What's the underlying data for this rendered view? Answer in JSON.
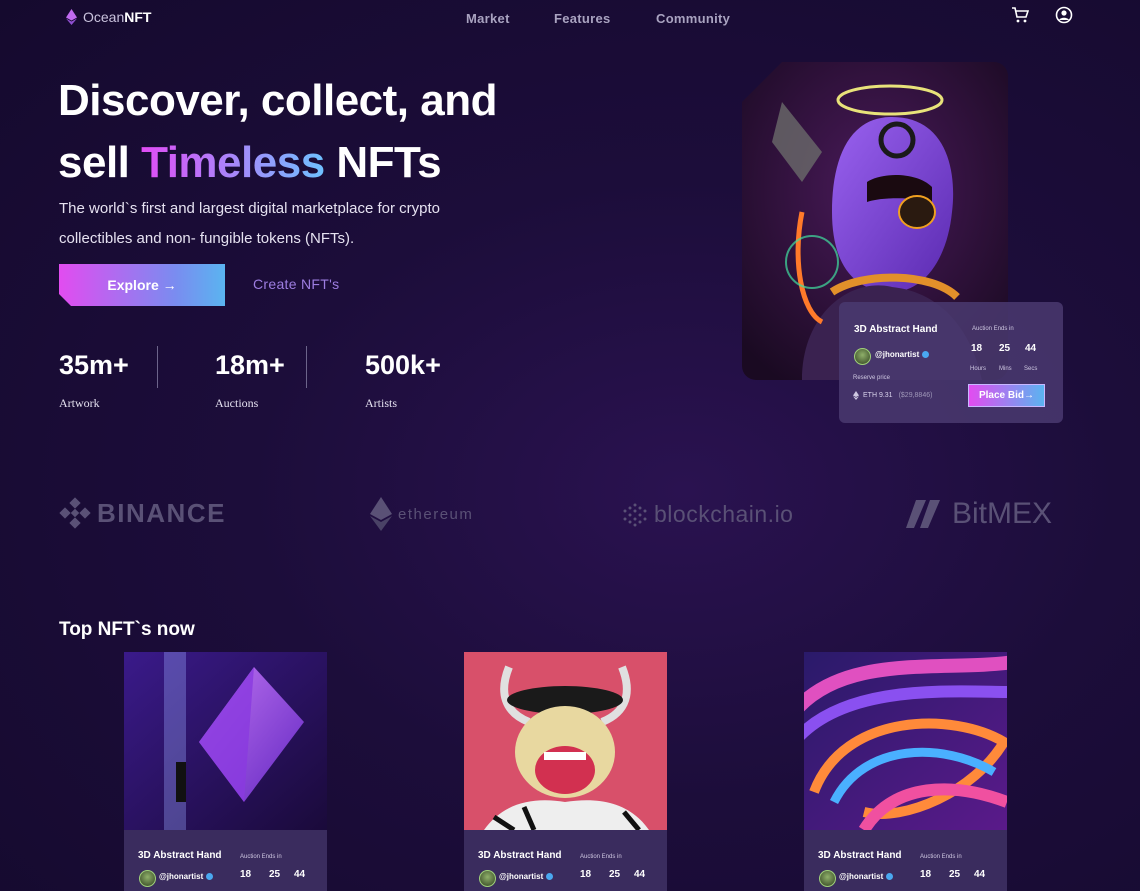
{
  "nav": {
    "logo_part1": "Ocean",
    "logo_part2": "NFT",
    "links": [
      "Market",
      "Features",
      "Community"
    ],
    "icons": [
      "cart-icon",
      "user-icon"
    ]
  },
  "hero": {
    "title_line1": "Discover, collect, and",
    "title_line2_pre": "sell ",
    "title_line2_accent": "Timeless",
    "title_line2_post": " NFTs",
    "subtitle": "The world`s first and largest digital marketplace for crypto collectibles and non- fungible tokens (NFTs).",
    "explore_label": "Explore →",
    "create_label": "Create NFT's",
    "stats": [
      {
        "value": "35m+",
        "label": "Artwork"
      },
      {
        "value": "18m+",
        "label": "Auctions"
      },
      {
        "value": "500k+",
        "label": "Artists"
      }
    ]
  },
  "featured": {
    "title": "3D Abstract Hand",
    "artist": "@jhonartist",
    "auction_label": "Auction Ends in",
    "hours": "18",
    "mins": "25",
    "secs": "44",
    "hours_label": "Hours",
    "mins_label": "Mins",
    "secs_label": "Secs",
    "reserve_label": "Reserve price",
    "eth": "ETH 9.31",
    "usd": "($29,8846)",
    "button": "Place Bid→"
  },
  "partners": [
    "BINANCE",
    "ethereum",
    "blockchain.io",
    "BitMEX"
  ],
  "top": {
    "title": "Top NFT`s now",
    "cards": [
      {
        "title": "3D Abstract Hand",
        "artist": "@jhonartist",
        "auction_label": "Auction Ends in",
        "h": "18",
        "m": "25",
        "s": "44"
      },
      {
        "title": "3D Abstract Hand",
        "artist": "@jhonartist",
        "auction_label": "Auction Ends in",
        "h": "18",
        "m": "25",
        "s": "44"
      },
      {
        "title": "3D Abstract Hand",
        "artist": "@jhonartist",
        "auction_label": "Auction Ends in",
        "h": "18",
        "m": "25",
        "s": "44"
      }
    ]
  }
}
